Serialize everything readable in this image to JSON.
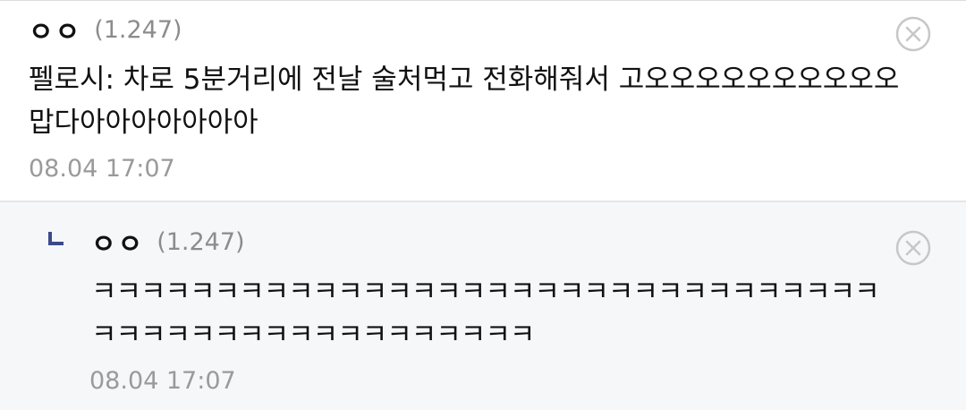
{
  "comment": {
    "author": "ㅇㅇ",
    "ip": "(1.247)",
    "text": "펠로시: 차로 5분거리에 전날 술처먹고 전화해줘서 고오오오오오오오오오오\n맙다아아아아아아아",
    "timestamp": "08.04 17:07",
    "delete_icon": "close-circle-icon"
  },
  "reply": {
    "indicator_icon": "reply-arrow-icon",
    "author": "ㅇㅇ",
    "ip": "(1.247)",
    "text": "ㅋㅋㅋㅋㅋㅋㅋㅋㅋㅋㅋㅋㅋㅋㅋㅋㅋㅋㅋㅋㅋㅋㅋㅋㅋㅋㅋㅋㅋㅋㅋㅋ\nㅋㅋㅋㅋㅋㅋㅋㅋㅋㅋㅋㅋㅋㅋㅋㅋㅋㅋ",
    "timestamp": "08.04 17:07",
    "delete_icon": "close-circle-icon"
  },
  "colors": {
    "reply_background": "#f6f7f9",
    "reply_mark": "#3b4a8c",
    "muted_text": "#9a9a9a"
  }
}
